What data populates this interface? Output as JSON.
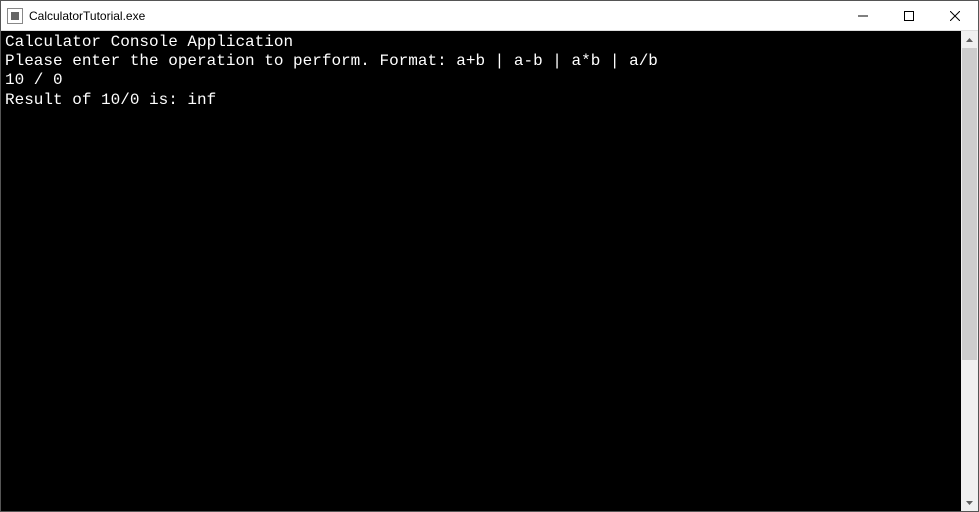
{
  "window": {
    "title": "CalculatorTutorial.exe"
  },
  "console": {
    "lines": [
      "Calculator Console Application",
      "",
      "Please enter the operation to perform. Format: a+b | a-b | a*b | a/b",
      "10 / 0",
      "Result of 10/0 is: inf"
    ]
  }
}
